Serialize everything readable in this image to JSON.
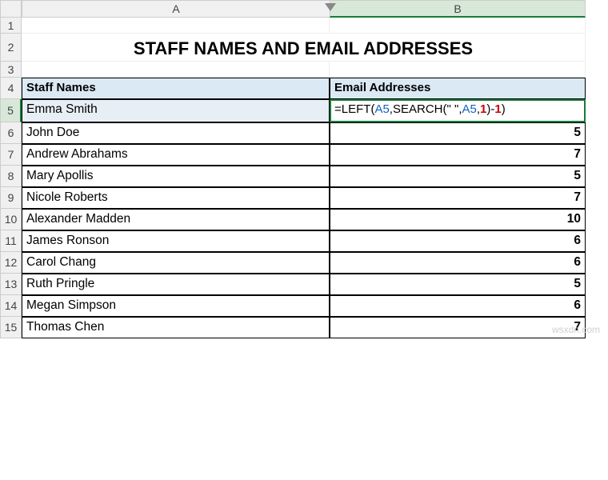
{
  "columns": {
    "A": "A",
    "B": "B"
  },
  "title": "STAFF NAMES AND EMAIL ADDRESSES",
  "headers": {
    "col_a": "Staff Names",
    "col_b": "Email Addresses"
  },
  "formula": {
    "prefix": "=",
    "fn1": "LEFT(",
    "ref1": "A5",
    "sep1": ",",
    "fn2": "SEARCH(",
    "str": "\" \"",
    "sep2": ",",
    "ref2": "A5",
    "sep3": ",",
    "num1": "1",
    "close1": ")-",
    "num2": "1",
    "close2": ")"
  },
  "rows": [
    {
      "n": "1"
    },
    {
      "n": "2"
    },
    {
      "n": "3"
    },
    {
      "n": "4"
    },
    {
      "n": "5",
      "name": "Emma Smith"
    },
    {
      "n": "6",
      "name": "John Doe",
      "val": "5"
    },
    {
      "n": "7",
      "name": "Andrew Abrahams",
      "val": "7"
    },
    {
      "n": "8",
      "name": "Mary Apollis",
      "val": "5"
    },
    {
      "n": "9",
      "name": "Nicole Roberts",
      "val": "7"
    },
    {
      "n": "10",
      "name": "Alexander Madden",
      "val": "10"
    },
    {
      "n": "11",
      "name": "James Ronson",
      "val": "6"
    },
    {
      "n": "12",
      "name": "Carol Chang",
      "val": "6"
    },
    {
      "n": "13",
      "name": "Ruth Pringle",
      "val": "5"
    },
    {
      "n": "14",
      "name": "Megan Simpson",
      "val": "6"
    },
    {
      "n": "15",
      "name": "Thomas Chen",
      "val": "7"
    }
  ],
  "watermark": "wsxdn.com"
}
